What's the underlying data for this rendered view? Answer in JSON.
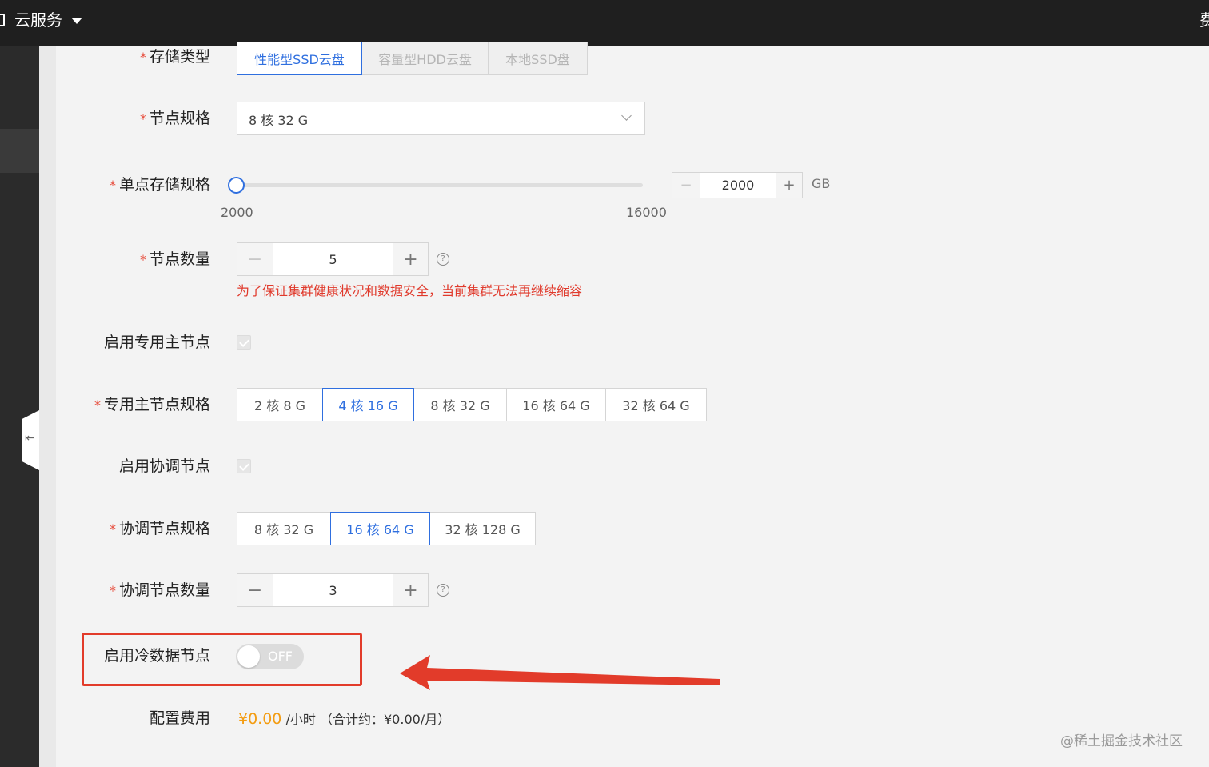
{
  "topbar": {
    "title": "云服务",
    "right_text": "费"
  },
  "form": {
    "storage_type": {
      "label": "存储类型",
      "options": [
        "性能型SSD云盘",
        "容量型HDD云盘",
        "本地SSD盘"
      ],
      "selected": "性能型SSD云盘"
    },
    "node_spec": {
      "label": "节点规格",
      "value": "8 核 32 G"
    },
    "node_storage": {
      "label": "单点存储规格",
      "slider_min": "2000",
      "slider_max": "16000",
      "value": "2000",
      "unit": "GB",
      "minus": "−",
      "plus": "+"
    },
    "node_count": {
      "label": "节点数量",
      "value": "5",
      "minus": "−",
      "plus": "+",
      "help": "?",
      "warning": "为了保证集群健康状况和数据安全，当前集群无法再继续缩容"
    },
    "dedicated_master": {
      "label": "启用专用主节点",
      "checked": true
    },
    "master_spec": {
      "label": "专用主节点规格",
      "options": [
        "2 核 8 G",
        "4 核 16 G",
        "8 核 32 G",
        "16 核 64 G",
        "32 核 64 G"
      ],
      "selected": "4 核 16 G"
    },
    "coordinator": {
      "label": "启用协调节点",
      "checked": true
    },
    "coordinator_spec": {
      "label": "协调节点规格",
      "options": [
        "8 核 32 G",
        "16 核 64 G",
        "32 核 128 G"
      ],
      "selected": "16 核 64 G"
    },
    "coordinator_count": {
      "label": "协调节点数量",
      "value": "3",
      "minus": "−",
      "plus": "+",
      "help": "?"
    },
    "cold_data": {
      "label": "启用冷数据节点",
      "switch_text": "OFF",
      "on": false
    },
    "fee": {
      "label": "配置费用",
      "amount": "¥0.00",
      "per_hour": "/小时",
      "monthly": "（合计约：¥0.00/月）"
    }
  },
  "annotation": {
    "highlight_color": "#e23b2a",
    "arrow_color": "#e23b2a"
  },
  "watermark": "@稀土掘金技术社区",
  "colors": {
    "accent": "#2f6fdf",
    "warning": "#e0392b",
    "price": "#f39c12",
    "topbar": "#1f1f1f"
  }
}
